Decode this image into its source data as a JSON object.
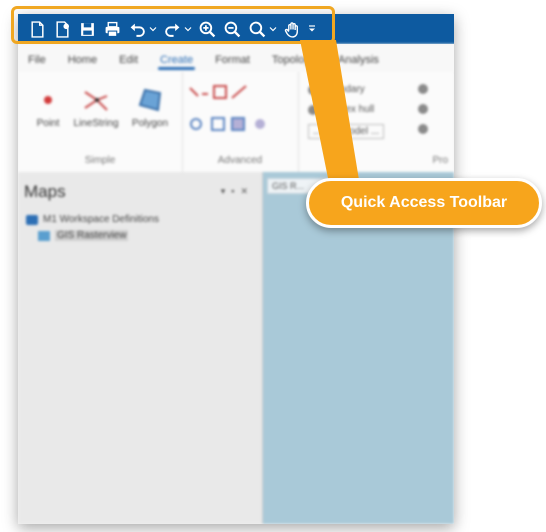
{
  "callout": {
    "text": "Quick Access Toolbar"
  },
  "quick_access_toolbar": {
    "buttons": [
      {
        "icon": "new-document-icon"
      },
      {
        "icon": "open-document-icon"
      },
      {
        "icon": "save-icon"
      },
      {
        "icon": "print-icon"
      },
      {
        "icon": "undo-icon",
        "has_dropdown": true
      },
      {
        "icon": "redo-icon",
        "has_dropdown": true
      },
      {
        "icon": "zoom-in-icon"
      },
      {
        "icon": "zoom-out-icon"
      },
      {
        "icon": "zoom-icon",
        "has_dropdown": true
      },
      {
        "icon": "pan-hand-icon"
      },
      {
        "icon": "customize-menu-icon"
      }
    ]
  },
  "ribbon": {
    "tabs": [
      "File",
      "Home",
      "Edit",
      "Create",
      "Format",
      "Topology",
      "Analysis"
    ],
    "active_tab": "Create",
    "groups": [
      {
        "label": "Simple",
        "buttons": [
          "Point",
          "LineString",
          "Polygon"
        ]
      },
      {
        "label": "Advanced",
        "buttons": []
      },
      {
        "label": "Pro",
        "items": [
          "Boundary",
          "Convex hull",
          "...ode model ..."
        ]
      }
    ]
  },
  "maps_panel": {
    "title": "Maps",
    "tree": [
      "M1 Workspace Definitions",
      "GIS Rasterview"
    ]
  },
  "map_view": {
    "tab_label": "GIS R..."
  },
  "colors": {
    "titlebar": "#0d5aa0",
    "highlight": "#f0a722",
    "callout": "#f7a51c",
    "map_background": "#a9c9d8"
  }
}
